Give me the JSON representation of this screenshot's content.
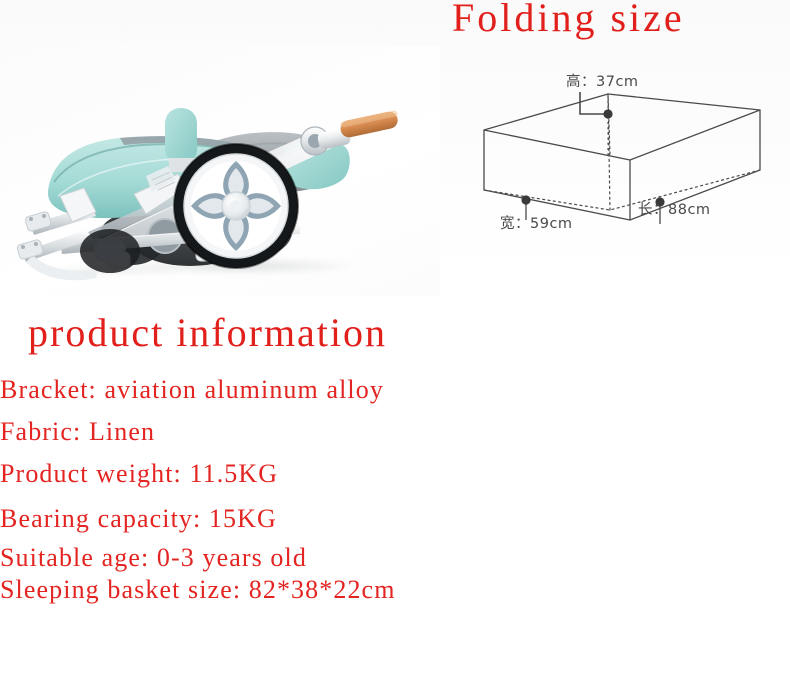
{
  "headings": {
    "folding_size": "Folding size",
    "product_information": "product information"
  },
  "colors": {
    "heading_red": "#e1201c",
    "spec_red": "#e32420",
    "diagram_line": "#4a4a4a",
    "fabric_mint": "#a9dcd8",
    "frame_white": "#f2f3f4",
    "handle_tan": "#d98b50"
  },
  "product_photo": {
    "alt": "folded baby stroller, mint green fabric with white aluminum frame and large spoked rear wheel",
    "fabric_color": "#a9dcd8",
    "frame_color": "#eef0f1",
    "handle_color": "#d98b50",
    "wheel_spoke_color": "#8fa5b3",
    "tire_color": "#1d1d1f"
  },
  "diagram": {
    "type": "3d-box-dimensions",
    "height_label": "高：37cm",
    "width_label": "宽：59cm",
    "length_label": "长：88cm",
    "height_cm": 37,
    "width_cm": 59,
    "length_cm": 88
  },
  "specs": [
    "Bracket: aviation aluminum alloy",
    "Fabric: Linen",
    "Product weight: 11.5KG",
    "Bearing capacity: 15KG",
    "Suitable age: 0-3 years old",
    "Sleeping basket size: 82*38*22cm"
  ]
}
